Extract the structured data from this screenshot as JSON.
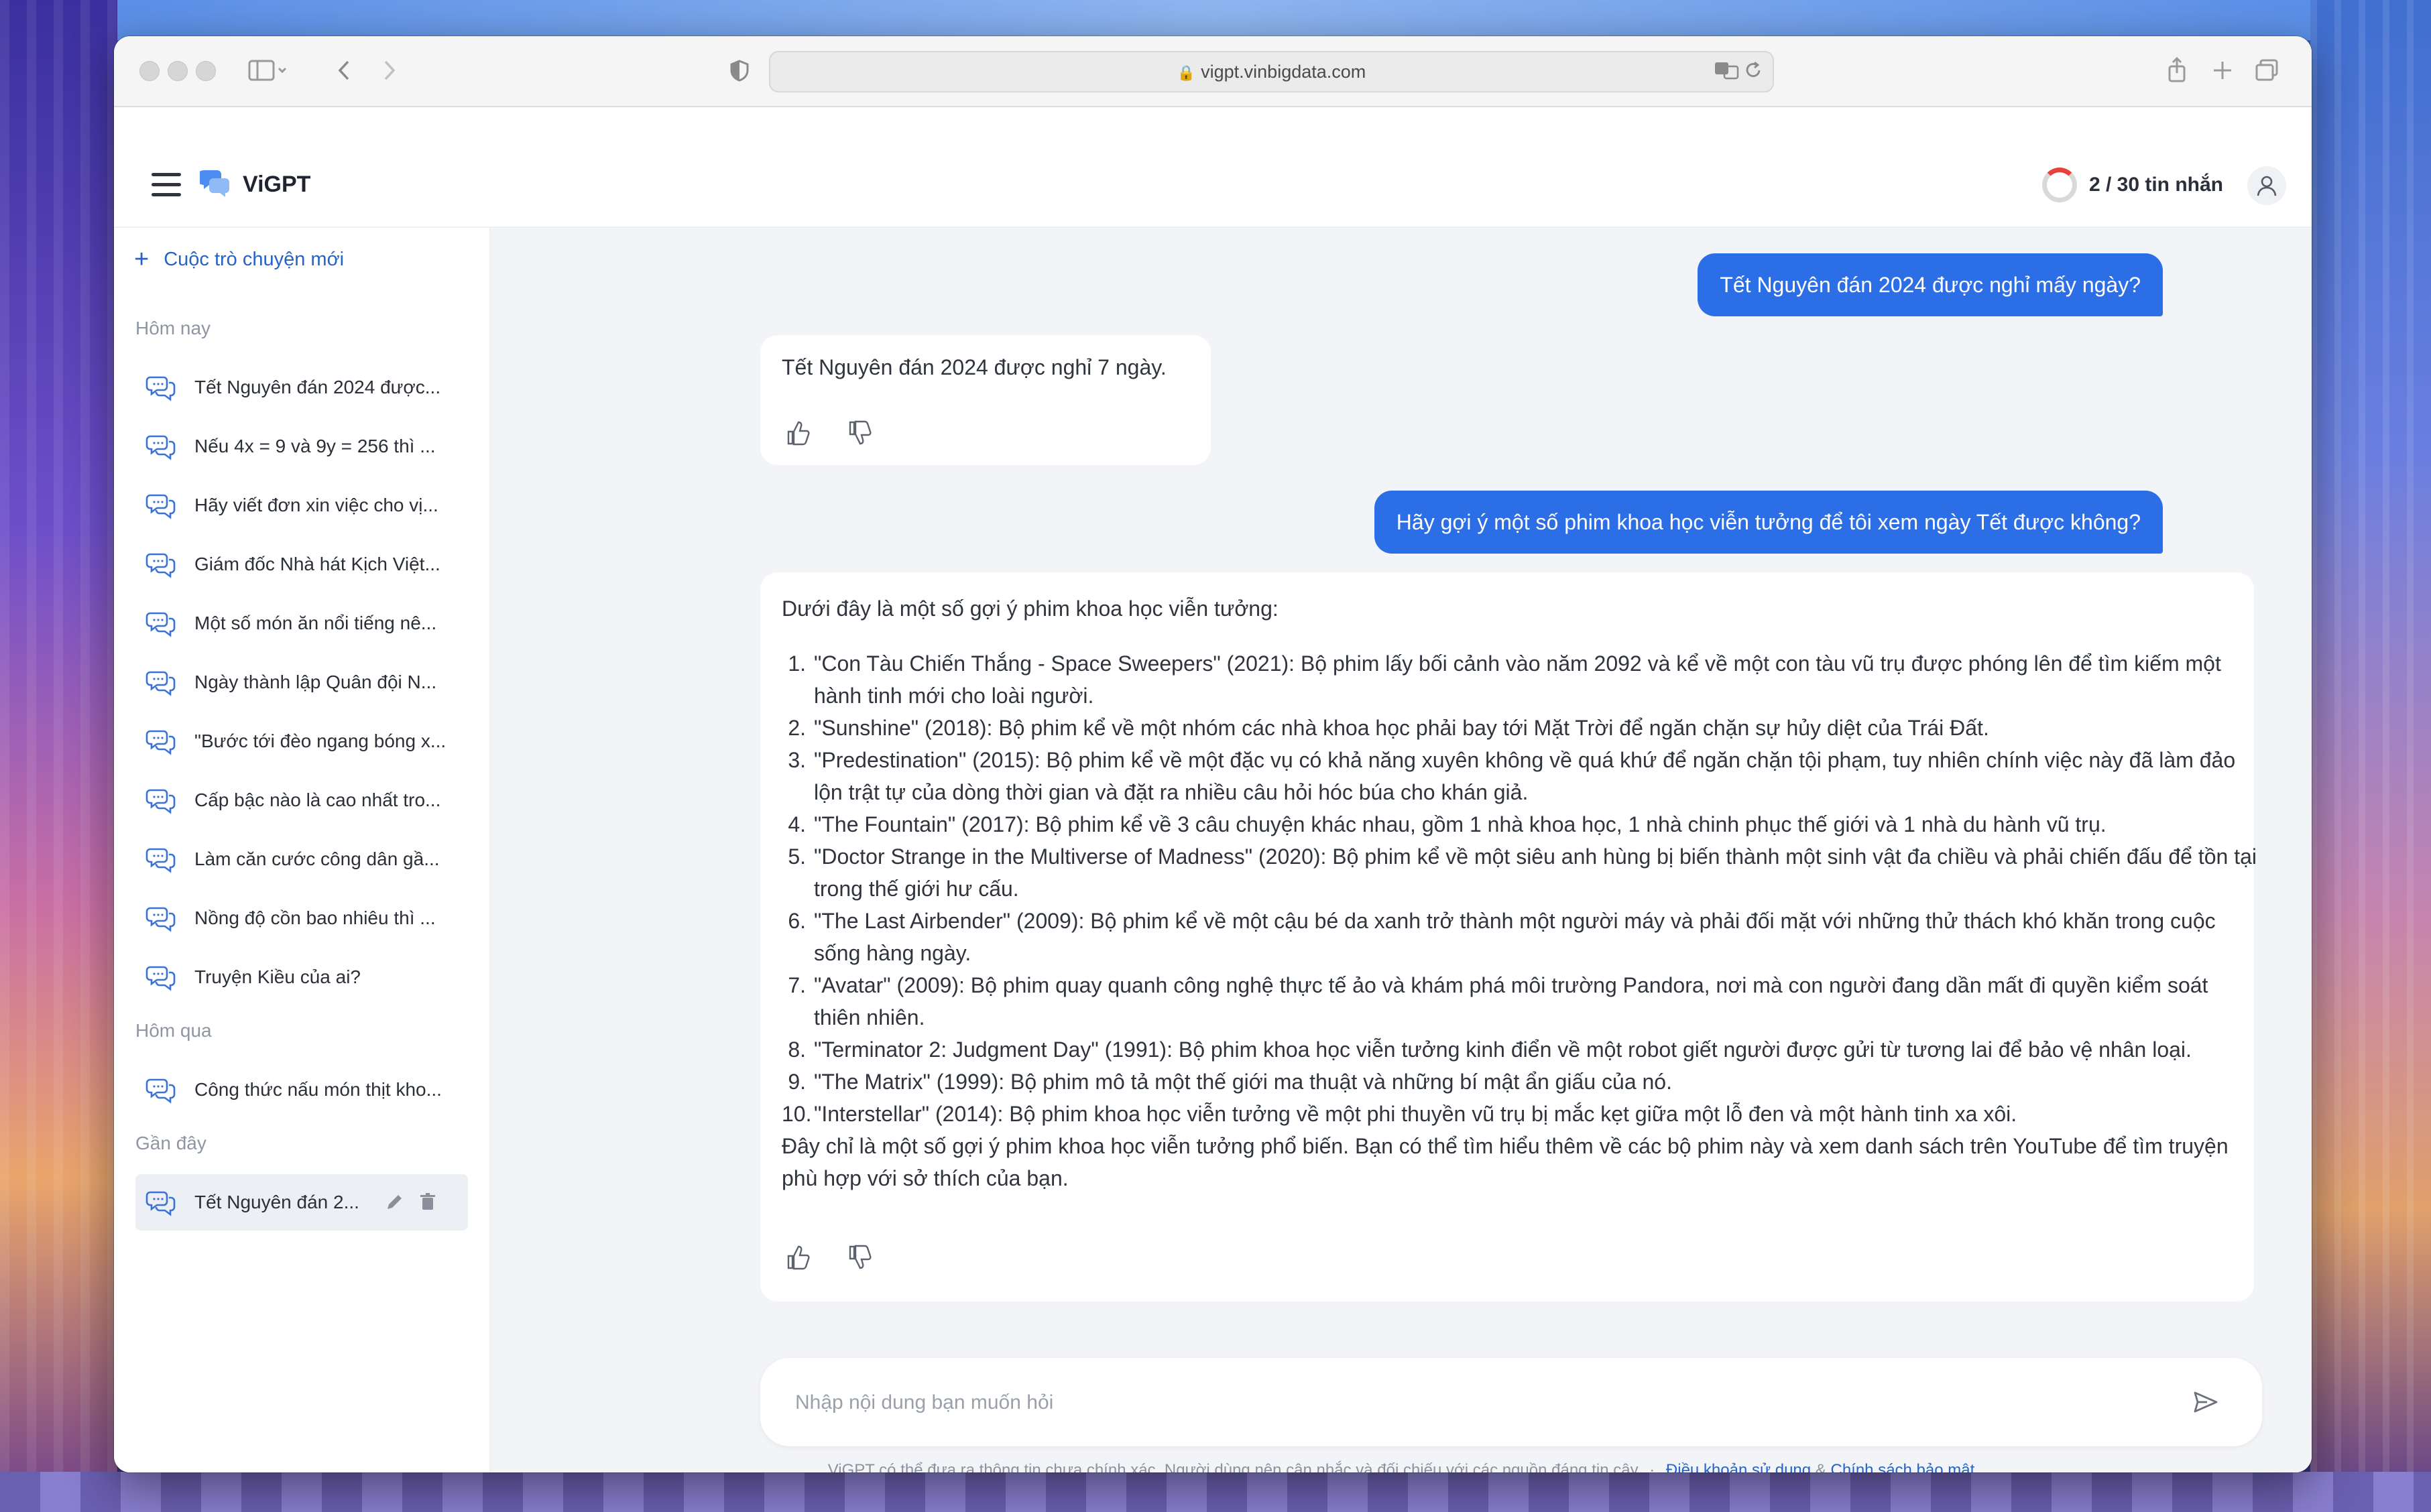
{
  "browser": {
    "url": "vigpt.vinbigdata.com"
  },
  "header": {
    "brand": "ViGPT",
    "quota": "2 / 30 tin nhắn"
  },
  "sidebar": {
    "new_chat": "Cuộc trò chuyện mới",
    "today_label": "Hôm nay",
    "today_items": [
      "Tết Nguyên đán 2024 được...",
      "Nếu 4x = 9 và 9y = 256 thì ...",
      "Hãy viết đơn xin việc cho vị...",
      "Giám đốc Nhà hát Kịch Việt...",
      "Một số món ăn nổi tiếng nê...",
      "Ngày thành lập Quân đội N...",
      "\"Bước tới đèo ngang bóng x...",
      "Cấp bậc nào là cao nhất tro...",
      "Làm căn cước công dân gầ...",
      "Nồng độ cồn bao nhiêu thì ...",
      "Truyện Kiều của ai?"
    ],
    "yesterday_label": "Hôm qua",
    "yesterday_items": [
      "Công thức nấu món thịt kho..."
    ],
    "recent_label": "Gần đây",
    "recent_items": [
      "Tết Nguyên đán 2..."
    ]
  },
  "chat": {
    "q1": "Tết Nguyên đán 2024 được nghỉ mấy ngày?",
    "a1": "Tết Nguyên đán 2024 được nghỉ 7 ngày.",
    "q2": "Hãy gợi ý một số phim khoa học viễn tưởng để tôi xem ngày Tết được không?",
    "a2_intro": "Dưới đây là một số gợi ý phim khoa học viễn tưởng:",
    "a2_items": [
      "\"Con Tàu Chiến Thắng - Space Sweepers\" (2021): Bộ phim lấy bối cảnh vào năm 2092 và kể về một con tàu vũ trụ được phóng lên để tìm kiếm một hành tinh mới cho loài người.",
      "\"Sunshine\" (2018): Bộ phim kể về một nhóm các nhà khoa học phải bay tới Mặt Trời để ngăn chặn sự hủy diệt của Trái Đất.",
      "\"Predestination\" (2015): Bộ phim kể về một đặc vụ có khả năng xuyên không về quá khứ để ngăn chặn tội phạm, tuy nhiên chính việc này đã làm đảo lộn trật tự của dòng thời gian và đặt ra nhiều câu hỏi hóc búa cho khán giả.",
      "\"The Fountain\" (2017): Bộ phim kể về 3 câu chuyện khác nhau, gồm 1 nhà khoa học, 1 nhà chinh phục thế giới và 1 nhà du hành vũ trụ.",
      "\"Doctor Strange in the Multiverse of Madness\" (2020): Bộ phim kể về một siêu anh hùng bị biến thành một sinh vật đa chiều và phải chiến đấu để tồn tại trong thế giới hư cấu.",
      "\"The Last Airbender\" (2009): Bộ phim kể về một cậu bé da xanh trở thành một người máy và phải đối mặt với những thử thách khó khăn trong cuộc sống hàng ngày.",
      "\"Avatar\" (2009): Bộ phim quay quanh công nghệ thực tế ảo và khám phá môi trường Pandora, nơi mà con người đang dần mất đi quyền kiểm soát thiên nhiên.",
      "\"Terminator 2: Judgment Day\" (1991): Bộ phim khoa học viễn tưởng kinh điển về một robot giết người được gửi từ tương lai để bảo vệ nhân loại.",
      "\"The Matrix\" (1999): Bộ phim mô tả một thế giới ma thuật và những bí mật ẩn giấu của nó.",
      "\"Interstellar\" (2014): Bộ phim khoa học viễn tưởng về một phi thuyền vũ trụ bị mắc kẹt giữa một lỗ đen và một hành tinh xa xôi."
    ],
    "a2_outro": "Đây chỉ là một số gợi ý phim khoa học viễn tưởng phổ biến. Bạn có thể tìm hiểu thêm về các bộ phim này và xem danh sách trên YouTube để tìm truyện phù hợp với sở thích của bạn."
  },
  "input": {
    "placeholder": "Nhập nội dung bạn muốn hỏi"
  },
  "footer": {
    "disclaimer": "ViGPT có thể đưa ra thông tin chưa chính xác. Người dùng nên cân nhắc và đối chiếu với các nguồn đáng tin cậy",
    "separator": "·",
    "terms": "Điều khoản sử dụng",
    "amp": "&",
    "privacy": "Chính sách bảo mật"
  },
  "colors": {
    "accent": "#2c6ee6",
    "link": "#2563c9",
    "quota_ring": "#e9423a"
  }
}
